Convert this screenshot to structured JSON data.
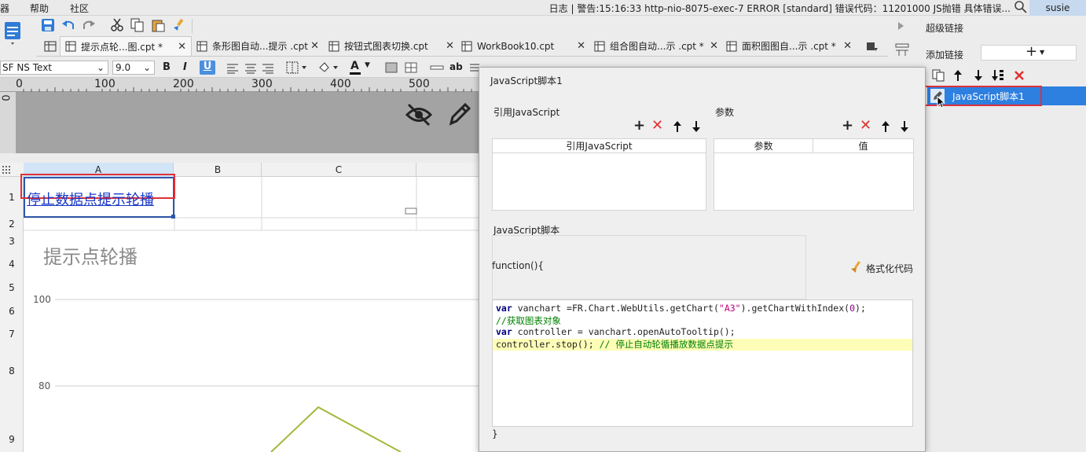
{
  "menubar": {
    "items": [
      "器",
      "帮助",
      "社区"
    ],
    "status": "日志 | 警告:15:16:33 http-nio-8075-exec-7 ERROR [standard] 错误代码：11201000 JS抛错 具体错误...",
    "user": "susie"
  },
  "tabs": [
    {
      "label": "提示点轮...图.cpt *",
      "active": true
    },
    {
      "label": "条形图自动...提示 .cpt",
      "active": false
    },
    {
      "label": "按钮式图表切换.cpt",
      "active": false
    },
    {
      "label": "WorkBook10.cpt",
      "active": false
    },
    {
      "label": "组合图自动...示 .cpt *",
      "active": false
    },
    {
      "label": "面积图图自...示 .cpt *",
      "active": false
    }
  ],
  "format": {
    "font": "SF NS Text",
    "size": "9.0",
    "bold": "B",
    "italic": "I",
    "underline": "U",
    "text_color": "A",
    "ab": "ab"
  },
  "ruler": {
    "marks": [
      "0",
      "100",
      "200",
      "300",
      "400",
      "500"
    ],
    "left_mark": "0"
  },
  "sheet": {
    "columns": [
      "A",
      "B",
      "C"
    ],
    "rows": [
      "1",
      "2",
      "3",
      "4",
      "5",
      "6",
      "7",
      "8",
      "9"
    ],
    "cell_a1": "停止数据点提示轮播",
    "chart_title": "提示点轮播",
    "y_labels": [
      "100",
      "80"
    ]
  },
  "dialog": {
    "title": "JavaScript脚本1",
    "ref_js_label": "引用JavaScript",
    "ref_js_column": "引用JavaScript",
    "params_label": "参数",
    "params_columns": [
      "参数",
      "值"
    ],
    "script_label": "JavaScript脚本",
    "function_open": "function(){",
    "format_code": "格式化代码",
    "function_close": "}",
    "code_lines": [
      "var vanchart =FR.Chart.WebUtils.getChart(\"A3\").getChartWithIndex(0);",
      "//获取图表对象",
      "var controller = vanchart.openAutoTooltip();",
      "controller.stop(); // 停止自动轮循播放数据点提示"
    ]
  },
  "right_panel": {
    "title": "超级链接",
    "add_link": "添加链接",
    "list_item": "JavaScript脚本1"
  },
  "chart_data": {
    "type": "line",
    "title": "提示点轮播",
    "y_ticks": [
      100,
      80
    ],
    "note": "partially visible line series"
  }
}
